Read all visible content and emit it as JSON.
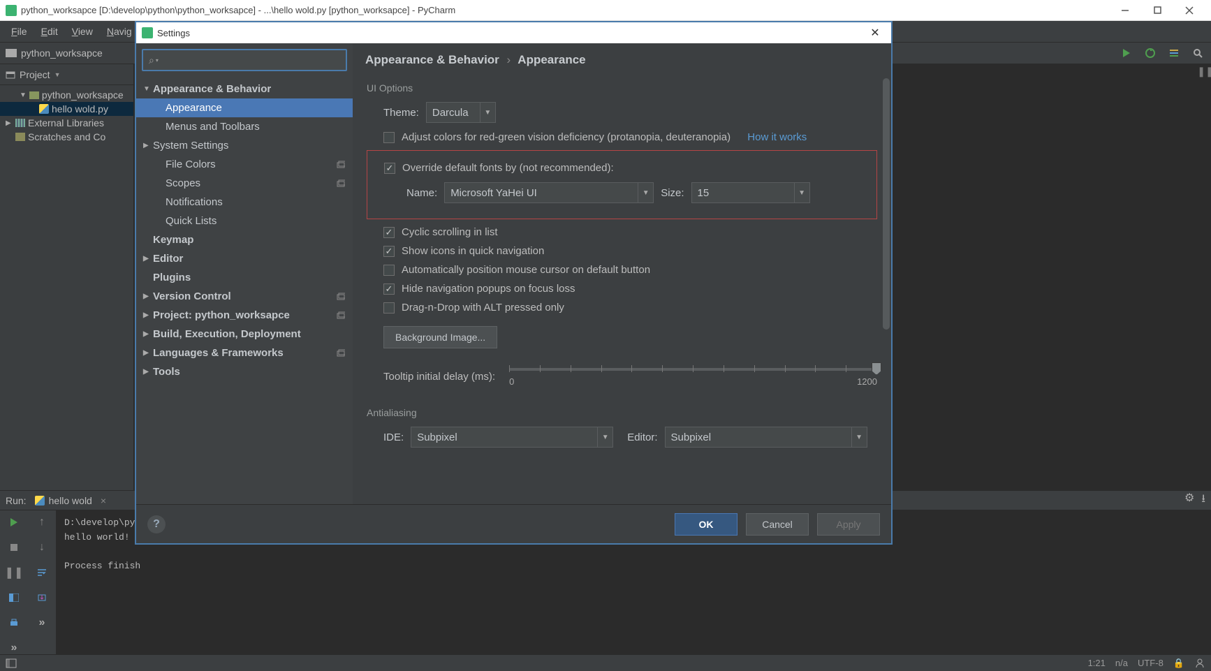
{
  "window": {
    "title": "python_worksapce [D:\\develop\\python\\python_worksapce] - ...\\hello wold.py [python_worksapce] - PyCharm"
  },
  "menu": [
    "File",
    "Edit",
    "View",
    "Navig"
  ],
  "nav": {
    "crumb": "python_worksapce"
  },
  "project": {
    "title": "Project",
    "root": "python_worksapce",
    "file": "hello wold.py",
    "external": "External Libraries",
    "scratches": "Scratches and Co"
  },
  "run": {
    "label": "Run:",
    "tab": "hello wold",
    "output": "D:\\develop\\py\nhello world!\n\nProcess finish"
  },
  "status": {
    "pos": "1:21",
    "insert": "n/a",
    "enc": "UTF-8",
    "le_suffix": ""
  },
  "settings": {
    "title": "Settings",
    "tree": {
      "appearance_behavior": "Appearance & Behavior",
      "appearance": "Appearance",
      "menus_toolbars": "Menus and Toolbars",
      "system_settings": "System Settings",
      "file_colors": "File Colors",
      "scopes": "Scopes",
      "notifications": "Notifications",
      "quick_lists": "Quick Lists",
      "keymap": "Keymap",
      "editor": "Editor",
      "plugins": "Plugins",
      "version_control": "Version Control",
      "project": "Project: python_worksapce",
      "build": "Build, Execution, Deployment",
      "lang": "Languages & Frameworks",
      "tools": "Tools"
    },
    "crumb": {
      "a": "Appearance & Behavior",
      "b": "Appearance"
    },
    "ui_options": "UI Options",
    "theme_label": "Theme:",
    "theme_value": "Darcula",
    "adjust_colors": "Adjust colors for red-green vision deficiency (protanopia, deuteranopia)",
    "how_it_works": "How it works",
    "override_fonts": "Override default fonts by (not recommended):",
    "name_label": "Name:",
    "font_name": "Microsoft YaHei UI",
    "size_label": "Size:",
    "font_size": "15",
    "cyclic": "Cyclic scrolling in list",
    "show_icons": "Show icons in quick navigation",
    "auto_mouse": "Automatically position mouse cursor on default button",
    "hide_nav": "Hide navigation popups on focus loss",
    "drag_drop": "Drag-n-Drop with ALT pressed only",
    "bg_image": "Background Image...",
    "tooltip_label": "Tooltip initial delay (ms):",
    "tooltip_min": "0",
    "tooltip_max": "1200",
    "antialiasing": "Antialiasing",
    "ide_label": "IDE:",
    "ide_value": "Subpixel",
    "editor_label": "Editor:",
    "editor_value": "Subpixel",
    "ok": "OK",
    "cancel": "Cancel",
    "apply": "Apply"
  }
}
